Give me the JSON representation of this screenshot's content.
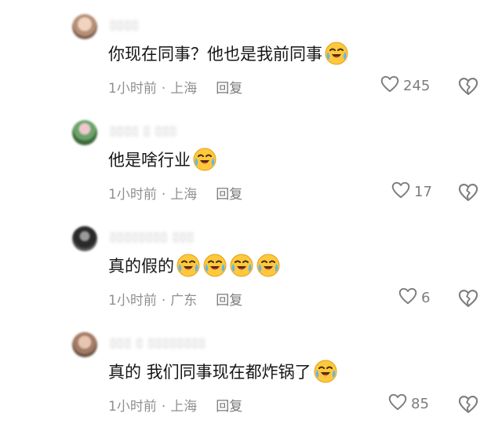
{
  "comments": [
    {
      "author": "▯▯▯▯",
      "text": "你现在同事？他也是我前同事",
      "emoji_count": 1,
      "time": "1小时前",
      "location": "上海",
      "reply_label": "回复",
      "likes": "245"
    },
    {
      "author": "▯▯▯▯ ▯ ▯▯▯",
      "text": "他是啥行业",
      "emoji_count": 1,
      "time": "1小时前",
      "location": "上海",
      "reply_label": "回复",
      "likes": "17"
    },
    {
      "author": "▯▯▯▯▯▯▯▯ ▯▯▯",
      "text": "真的假的",
      "emoji_count": 4,
      "time": "1小时前",
      "location": "广东",
      "reply_label": "回复",
      "likes": "6"
    },
    {
      "author": "▯▯▯ ▯ ▯▯▯▯▯▯▯▯",
      "text": "真的 我们同事现在都炸锅了",
      "emoji_count": 1,
      "time": "1小时前",
      "location": "上海",
      "reply_label": "回复",
      "likes": "85"
    }
  ],
  "icons": {
    "like": "heart-outline-icon",
    "dislike": "broken-heart-icon",
    "emoji": "crying-laughing-emoji"
  },
  "colors": {
    "text": "#161616",
    "meta": "#8f8f8f",
    "emoji": "#ffc83d"
  }
}
